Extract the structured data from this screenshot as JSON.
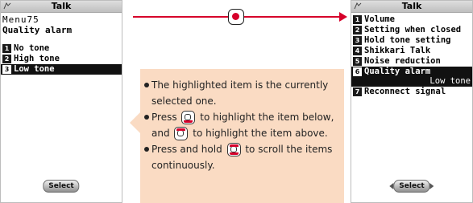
{
  "left_screen": {
    "title": "Talk",
    "menu_number": "Menu75",
    "header": "Quality alarm",
    "items": [
      {
        "num": "1",
        "label": "No tone",
        "selected": false
      },
      {
        "num": "2",
        "label": "High tone",
        "selected": false
      },
      {
        "num": "3",
        "label": "Low tone",
        "selected": true
      }
    ],
    "softkey": "Select"
  },
  "right_screen": {
    "title": "Talk",
    "items": [
      {
        "num": "1",
        "label": "Volume"
      },
      {
        "num": "2",
        "label": "Setting when closed"
      },
      {
        "num": "3",
        "label": "Hold tone setting"
      },
      {
        "num": "4",
        "label": "Shikkari Talk"
      },
      {
        "num": "5",
        "label": "Noise reduction"
      },
      {
        "num": "6",
        "label": "Quality alarm",
        "value": "Low tone",
        "selected": true
      },
      {
        "num": "7",
        "label": "Reconnect signal"
      }
    ],
    "softkey": "Select"
  },
  "callout": {
    "b1": "The highlighted item is the currently selected one.",
    "b2_a": "Press",
    "b2_b": "to highlight the item below, and",
    "b2_c": "to highlight the item above.",
    "b3_a": "Press and hold",
    "b3_b": "to scroll the items continuously."
  },
  "icons": {
    "center_key": "center-key-icon",
    "down_key": "multi-key-down-icon",
    "up_key": "multi-key-up-icon",
    "updown_key": "multi-key-updown-icon"
  },
  "colors": {
    "accent": "#d6002a",
    "callout_bg": "#fadbc3",
    "highlight": "#111111"
  }
}
